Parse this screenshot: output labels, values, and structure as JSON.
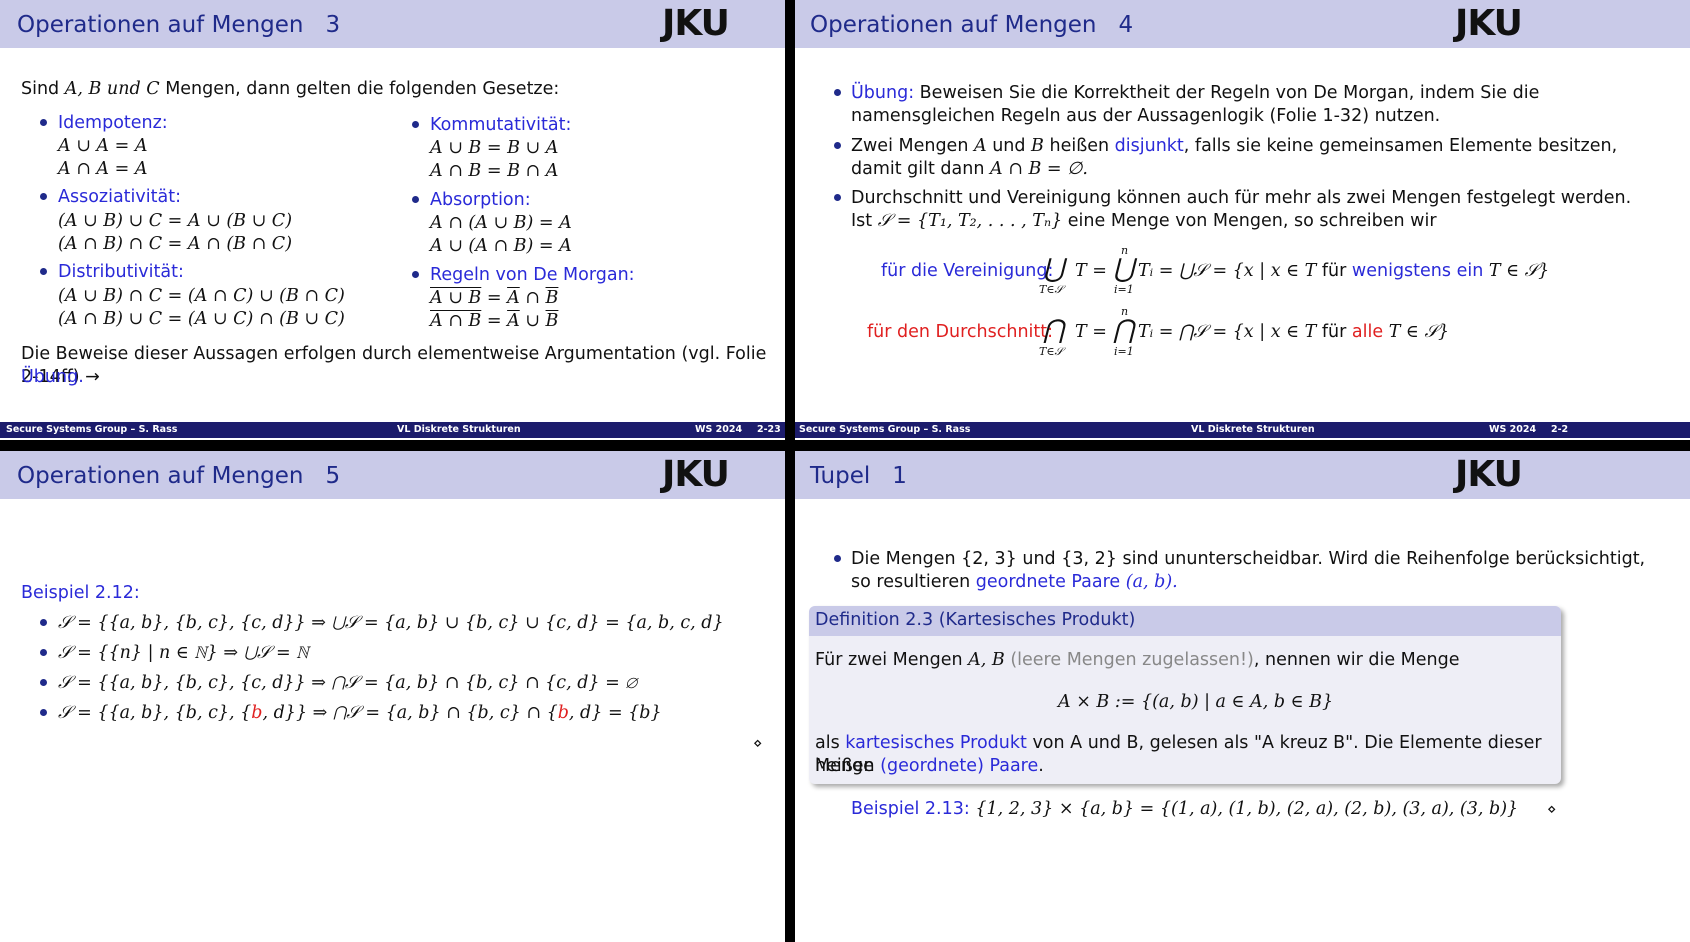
{
  "footer": {
    "left": "Secure Systems Group – S. Rass",
    "center": "VL Diskrete Strukturen",
    "right": "WS 2024"
  },
  "logo": "JKU",
  "slide1": {
    "title": "Operationen auf Mengen",
    "num": "3",
    "page": "2-23",
    "intro_pre": "Sind ",
    "intro_post": " Mengen, dann gelten die folgenden Gesetze:",
    "intro_sets": "A, B und C",
    "idem": {
      "h": "Idempotenz:",
      "l1": "A ∪ A = A",
      "l2": "A ∩ A = A"
    },
    "komm": {
      "h": "Kommutativität:",
      "l1": "A ∪ B = B ∪ A",
      "l2": "A ∩ B = B ∩ A"
    },
    "asso": {
      "h": "Assoziativität:",
      "l1": "(A ∪ B) ∪ C = A ∪ (B ∪ C)",
      "l2": "(A ∩ B) ∩ C = A ∩ (B ∩ C)"
    },
    "abs": {
      "h": "Absorption:",
      "l1": "A ∩ (A ∪ B) = A",
      "l2": "A ∪ (A ∩ B) = A"
    },
    "dist": {
      "h": "Distributivität:",
      "l1": "(A ∪ B) ∩ C = (A ∩ C) ∪ (B ∩ C)",
      "l2": "(A ∩ B) ∪ C = (A ∪ C) ∩ (B ∪ C)"
    },
    "morgan": {
      "h": "Regeln von De Morgan:"
    },
    "proof": "Die Beweise dieser Aussagen erfolgen durch elementweise Argumentation (vgl. Folie 2-14ff) →",
    "uebung": "Übung."
  },
  "slide2": {
    "title": "Operationen auf Mengen",
    "num": "4",
    "page": "2-2",
    "b1_label": "Übung:",
    "b1_text": " Beweisen Sie die Korrektheit der Regeln von De Morgan, indem Sie die",
    "b1_text2": "namensgleichen Regeln aus der Aussagenlogik (Folie 1-32) nutzen.",
    "b2_a": "Zwei Mengen ",
    "b2_b": " und ",
    "b2_c": " heißen ",
    "b2_link": "disjunkt",
    "b2_d": ", falls sie keine gemeinsamen Elemente besitzen,",
    "b2_e": "damit gilt dann ",
    "b2_f": "A ∩ B = ∅.",
    "b3_1": "Durchschnitt und Vereinigung können auch für mehr als zwei Mengen festgelegt werden.",
    "b3_2a": "Ist ",
    "b3_2b": "𝒮 = {T₁, T₂, . . . , Tₙ}",
    "b3_2c": " eine Menge von Mengen, so schreiben wir",
    "ver_label": "für die Vereinigung:",
    "ver_formula": "T = ",
    "ver_formula2": "Tᵢ = ⋃𝒮 = {x | x ∈ T ",
    "ver_fuer": "für ",
    "ver_w": "wenigstens ein",
    "ver_end": " T ∈ 𝒮}",
    "dur_label": "für den Durchschnitt:",
    "dur_formula2": "Tᵢ = ⋂𝒮 = {x | x ∈ T ",
    "dur_fuer": "für ",
    "dur_alle": "alle",
    "dur_end": " T ∈ 𝒮}",
    "sub_t": "T∈𝒮",
    "sub_i": "i=1",
    "sup_n": "n"
  },
  "slide3": {
    "title": "Operationen auf Mengen",
    "num": "5",
    "bsp": "Beispiel 2.12:",
    "l1": "𝒮 = {{a, b}, {b, c}, {c, d}} ⇒ ⋃𝒮 = {a, b} ∪ {b, c} ∪ {c, d} = {a, b, c, d}",
    "l2": "𝒮 = {{n} | n ∈ ℕ} ⇒ ⋃𝒮 = ℕ",
    "l3": "𝒮 = {{a, b}, {b, c}, {c, d}} ⇒ ⋂𝒮 = {a, b} ∩ {b, c} ∩ {c, d} = ∅",
    "l4a": "𝒮 = {{a, b}, {b, c}, {",
    "l4b": "b",
    "l4c": ", d}} ⇒ ⋂𝒮 = {a, b} ∩ {b, c} ∩ {",
    "l4d": "b",
    "l4e": ", d} = {b}",
    "end": "⋄"
  },
  "slide4": {
    "title": "Tupel",
    "num": "1",
    "b1a": "Die Mengen {2, 3} und {3, 2} sind ununterscheidbar. Wird die Reihenfolge berücksichtigt,",
    "b1b": "so resultieren ",
    "b1link": "geordnete Paare",
    "b1c": " (a, b).",
    "def_title": "Definition 2.3 (Kartesisches Produkt)",
    "def1a": "Für zwei Mengen ",
    "def1b": "A, B",
    "def1c": " (leere Mengen zugelassen!)",
    "def1d": ", nennen wir die Menge",
    "def_formula": "A × B := {(a, b) | a ∈ A, b ∈ B}",
    "def2a": "als ",
    "def2link": "kartesisches Produkt",
    "def2b": " von A und B, gelesen als \"A kreuz B\". Die Elemente dieser Menge",
    "def3a": "heißen ",
    "def3link": "(geordnete) Paare",
    ".": ".",
    "bsp": "Beispiel 2.13:",
    "bsp_formula": "{1, 2, 3} × {a, b} = {(1, a), (1, b), (2, a), (2, b), (3, a), (3, b)}",
    "end": "⋄"
  }
}
